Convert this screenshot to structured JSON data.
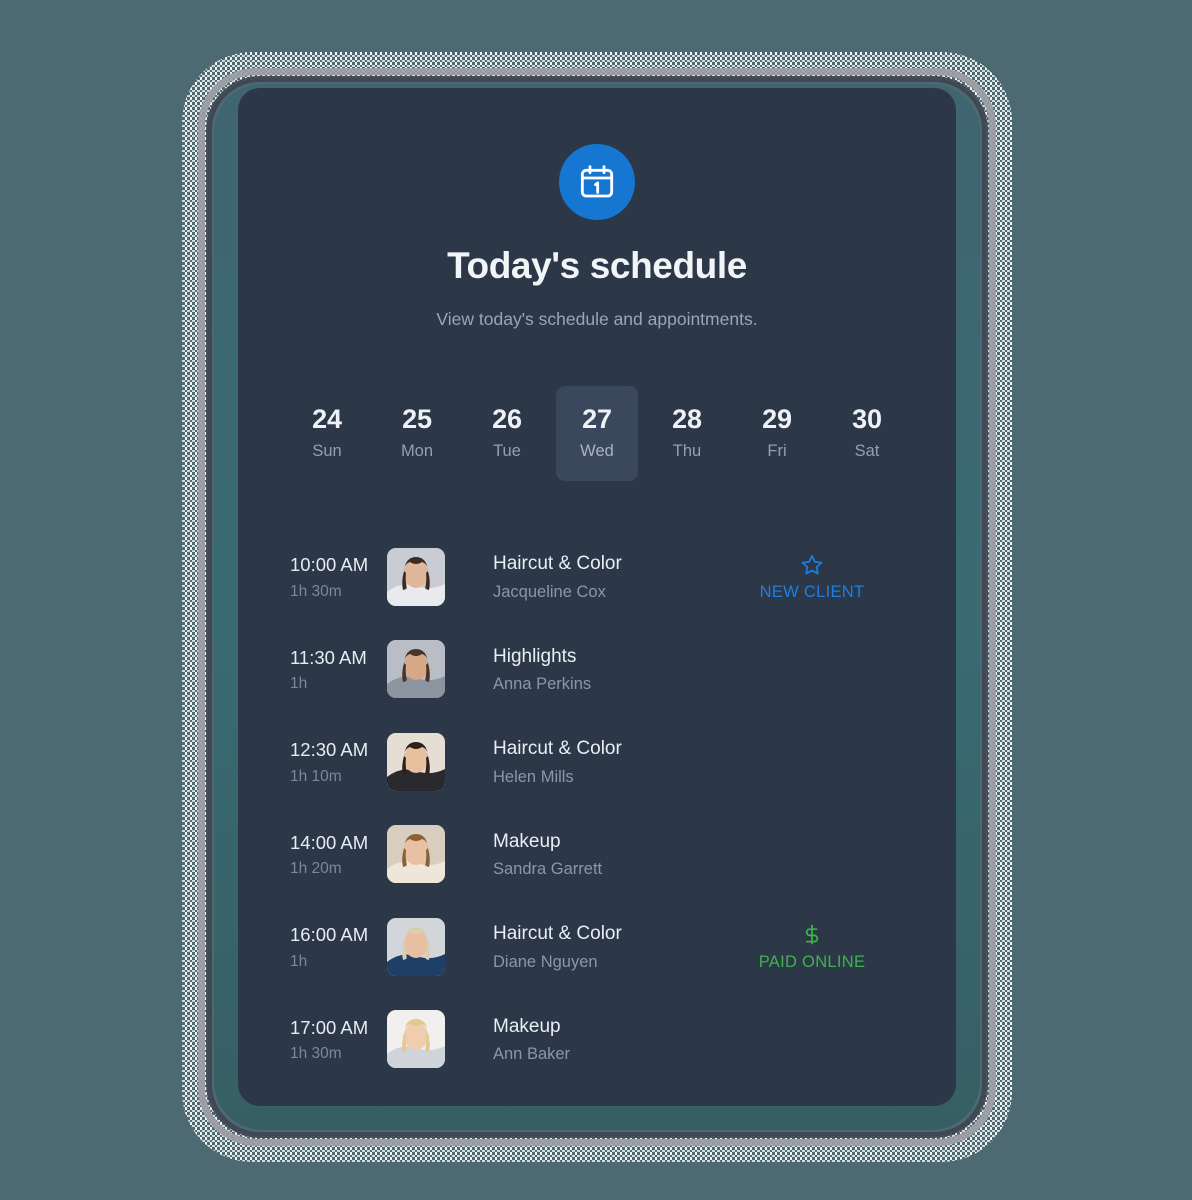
{
  "theme": {
    "page_background": "#4d6a72",
    "card_background": "#2c3748",
    "accent_blue": "#1577d2",
    "tag_new_client_color": "#1d7fe0",
    "tag_paid_color": "#3bb54a",
    "selected_chip_background": "#3b475d"
  },
  "header": {
    "icon": "calendar-icon",
    "title": "Today's schedule",
    "subtitle": "View today's schedule and appointments."
  },
  "date_strip": {
    "days": [
      {
        "num": "24",
        "dow": "Sun",
        "selected": false
      },
      {
        "num": "25",
        "dow": "Mon",
        "selected": false
      },
      {
        "num": "26",
        "dow": "Tue",
        "selected": false
      },
      {
        "num": "27",
        "dow": "Wed",
        "selected": true
      },
      {
        "num": "28",
        "dow": "Thu",
        "selected": false
      },
      {
        "num": "29",
        "dow": "Fri",
        "selected": false
      },
      {
        "num": "30",
        "dow": "Sat",
        "selected": false
      }
    ]
  },
  "appointments": [
    {
      "time": "10:00 AM",
      "duration": "1h 30m",
      "service": "Haircut & Color",
      "client": "Jacqueline Cox",
      "avatar": "client-photo-jacqueline-cox",
      "tag": {
        "type": "new-client",
        "icon": "star-icon",
        "label": "NEW CLIENT"
      }
    },
    {
      "time": "11:30 AM",
      "duration": "1h",
      "service": "Highlights",
      "client": "Anna Perkins",
      "avatar": "client-photo-anna-perkins",
      "tag": null
    },
    {
      "time": "12:30 AM",
      "duration": "1h 10m",
      "service": "Haircut & Color",
      "client": "Helen Mills",
      "avatar": "client-photo-helen-mills",
      "tag": null
    },
    {
      "time": "14:00 AM",
      "duration": "1h 20m",
      "service": "Makeup",
      "client": "Sandra Garrett",
      "avatar": "client-photo-sandra-garrett",
      "tag": null
    },
    {
      "time": "16:00 AM",
      "duration": "1h",
      "service": "Haircut & Color",
      "client": "Diane Nguyen",
      "avatar": "client-photo-diane-nguyen",
      "tag": {
        "type": "paid-online",
        "icon": "dollar-icon",
        "label": "PAID ONLINE"
      }
    },
    {
      "time": "17:00 AM",
      "duration": "1h 30m",
      "service": "Makeup",
      "client": "Ann Baker",
      "avatar": "client-photo-ann-baker",
      "tag": null
    }
  ]
}
